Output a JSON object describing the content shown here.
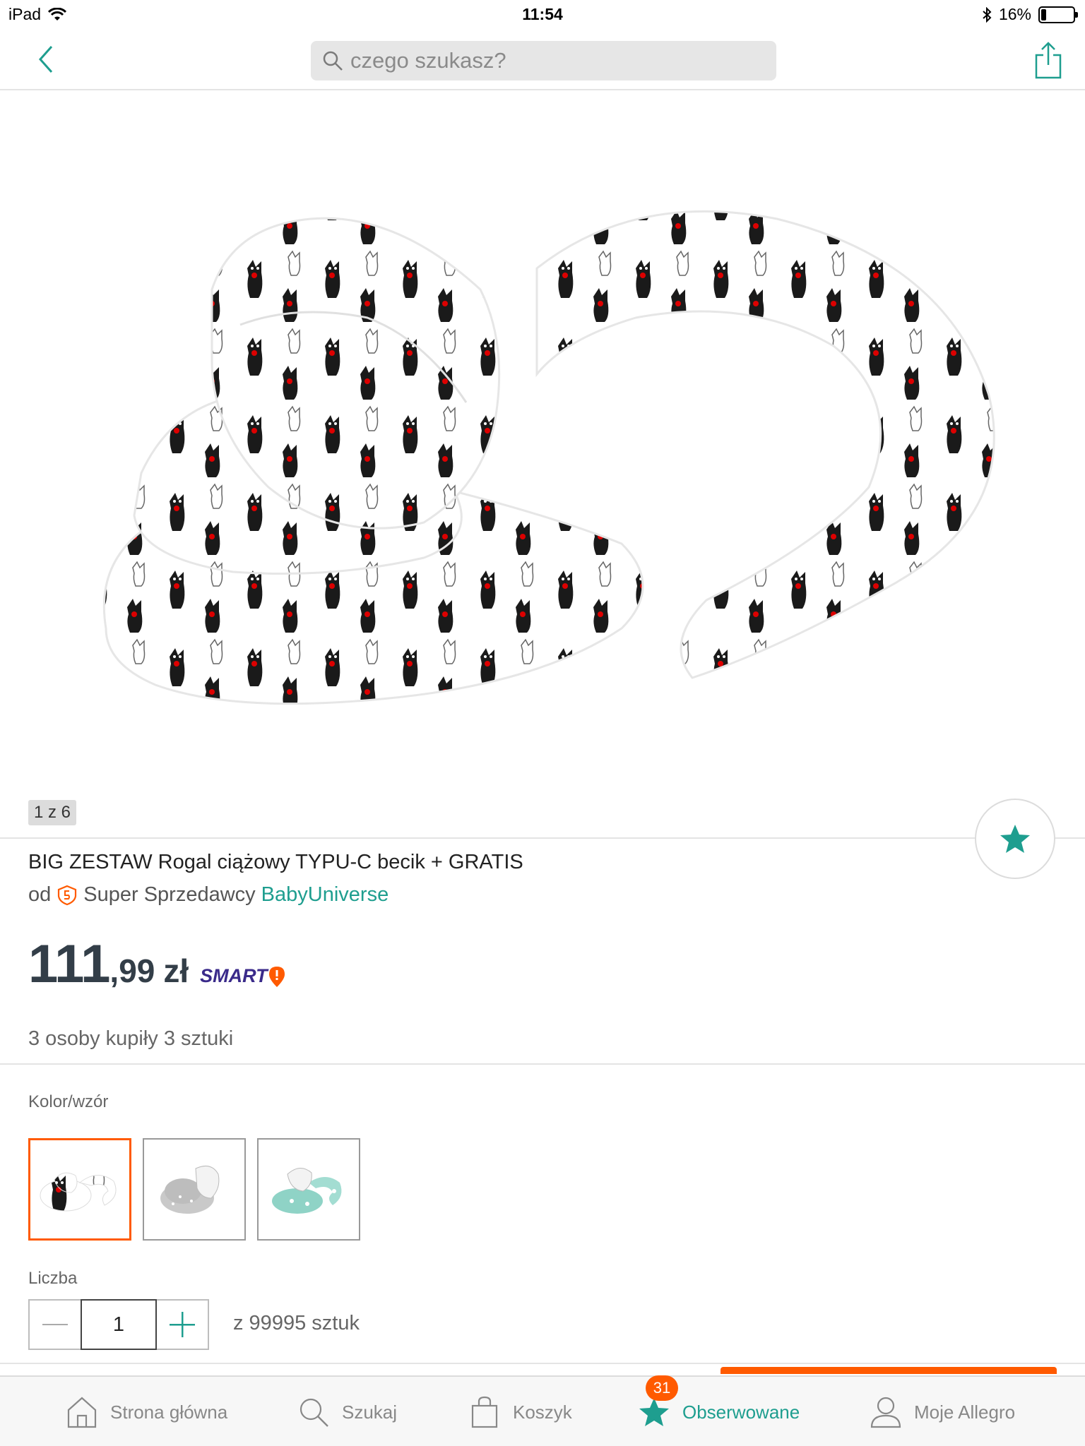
{
  "status_bar": {
    "device": "iPad",
    "time": "11:54",
    "battery_percent": "16%",
    "battery_level": 0.16
  },
  "nav": {
    "search_placeholder": "czego szukasz?"
  },
  "image": {
    "counter": "1 z 6"
  },
  "product": {
    "title": "BIG ZESTAW Rogal ciążowy TYPU-C becik + GRATIS",
    "seller_prefix": "od",
    "seller_badge": "Super Sprzedawcy",
    "seller_name": "BabyUniverse",
    "price_int": "111",
    "price_dec": ",99",
    "currency": "zł",
    "smart_label": "SMART",
    "bought": "3 osoby kupiły 3 sztuki"
  },
  "variants": {
    "label": "Kolor/wzór",
    "items": [
      {
        "name": "cats-white",
        "selected": true
      },
      {
        "name": "grey-dots",
        "selected": false
      },
      {
        "name": "mint-stars",
        "selected": false
      }
    ]
  },
  "quantity": {
    "label": "Liczba",
    "value": "1",
    "available": "z 99995 sztuk"
  },
  "tab_bar": {
    "items": [
      {
        "label": "Strona główna",
        "icon": "home-icon"
      },
      {
        "label": "Szukaj",
        "icon": "search-icon"
      },
      {
        "label": "Koszyk",
        "icon": "bag-icon"
      },
      {
        "label": "Obserwowane",
        "icon": "star-icon",
        "badge": "31",
        "active": true
      },
      {
        "label": "Moje Allegro",
        "icon": "user-icon"
      }
    ]
  },
  "colors": {
    "accent": "#1e9e8f",
    "brand_orange": "#ff5a00",
    "price": "#333e48"
  }
}
